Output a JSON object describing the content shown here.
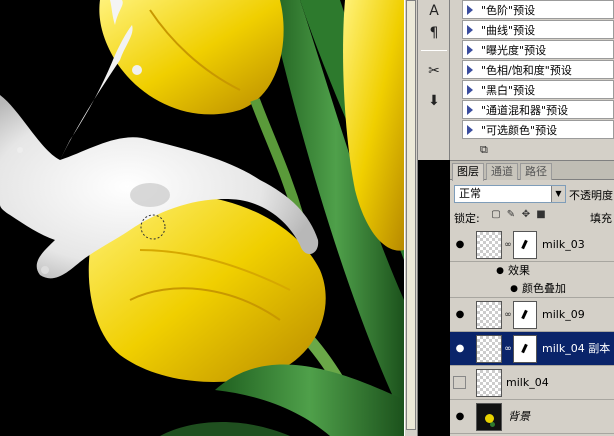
{
  "tools": {
    "items": [
      {
        "icon": "character-icon",
        "glyph": "A"
      },
      {
        "icon": "paragraph-icon",
        "glyph": "¶"
      },
      {
        "icon": "tools-icon",
        "glyph": "✂"
      },
      {
        "icon": "stamp-icon",
        "glyph": "⬇"
      }
    ]
  },
  "presets": {
    "items": [
      "\"色阶\"预设",
      "\"曲线\"预设",
      "\"曝光度\"预设",
      "\"色相/饱和度\"预设",
      "\"黑白\"预设",
      "\"通道混和器\"预设",
      "\"可选颜色\"预设"
    ]
  },
  "layers_panel": {
    "tabs": [
      "图层",
      "通道",
      "路径"
    ],
    "active_tab": 0,
    "blend_mode": "正常",
    "opacity_label": "不透明度",
    "lock_label": "锁定:",
    "fill_label": "填充",
    "effects_label": "效果",
    "color_overlay_label": "颜色叠加",
    "layers": [
      {
        "name": "milk_03",
        "visible": true,
        "selected": false,
        "mask": "dark"
      },
      {
        "name": "milk_09",
        "visible": true,
        "selected": false,
        "mask": "light"
      },
      {
        "name": "milk_04 副本",
        "visible": true,
        "selected": true,
        "mask": "light"
      },
      {
        "name": "milk_04",
        "visible": false,
        "selected": false,
        "mask": "none"
      },
      {
        "name": "背景",
        "visible": true,
        "selected": false,
        "mask": "background"
      }
    ]
  },
  "colors": {
    "panel_bg": "#d4d0c8",
    "selection": "#0a246a",
    "tulip_yellow": "#f2d20a",
    "leaf_green": "#3f8f3a"
  }
}
